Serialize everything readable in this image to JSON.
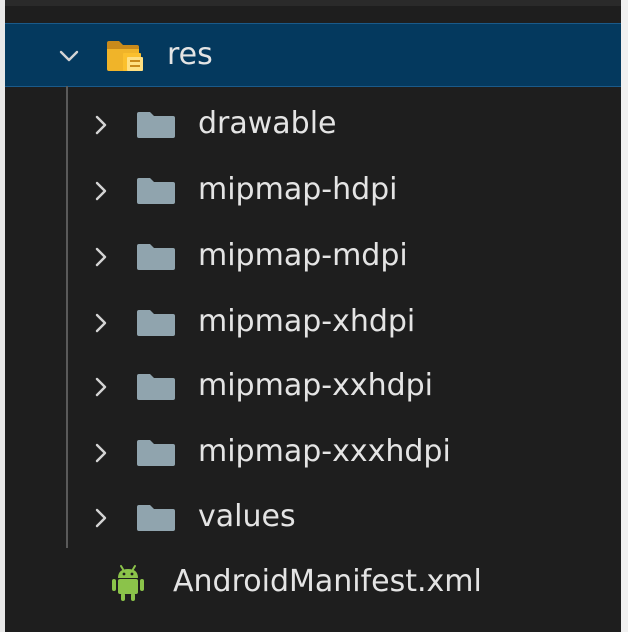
{
  "explorer": {
    "root": {
      "label": "res",
      "expanded": true,
      "icon": "folder-open-icon"
    },
    "children": [
      {
        "label": "drawable",
        "icon": "folder-icon",
        "expanded": false
      },
      {
        "label": "mipmap-hdpi",
        "icon": "folder-icon",
        "expanded": false
      },
      {
        "label": "mipmap-mdpi",
        "icon": "folder-icon",
        "expanded": false
      },
      {
        "label": "mipmap-xhdpi",
        "icon": "folder-icon",
        "expanded": false
      },
      {
        "label": "mipmap-xxhdpi",
        "icon": "folder-icon",
        "expanded": false
      },
      {
        "label": "mipmap-xxxhdpi",
        "icon": "folder-icon",
        "expanded": false
      },
      {
        "label": "values",
        "icon": "folder-icon",
        "expanded": false
      }
    ],
    "file": {
      "label": "AndroidManifest.xml",
      "icon": "android-icon"
    }
  },
  "colors": {
    "selection_bg": "#04395e",
    "folder_gray": "#90a4ae",
    "folder_open_orange": "#f0b429",
    "android_green": "#8bc34a",
    "text": "#e4e4e4",
    "background": "#1e1e1e"
  }
}
